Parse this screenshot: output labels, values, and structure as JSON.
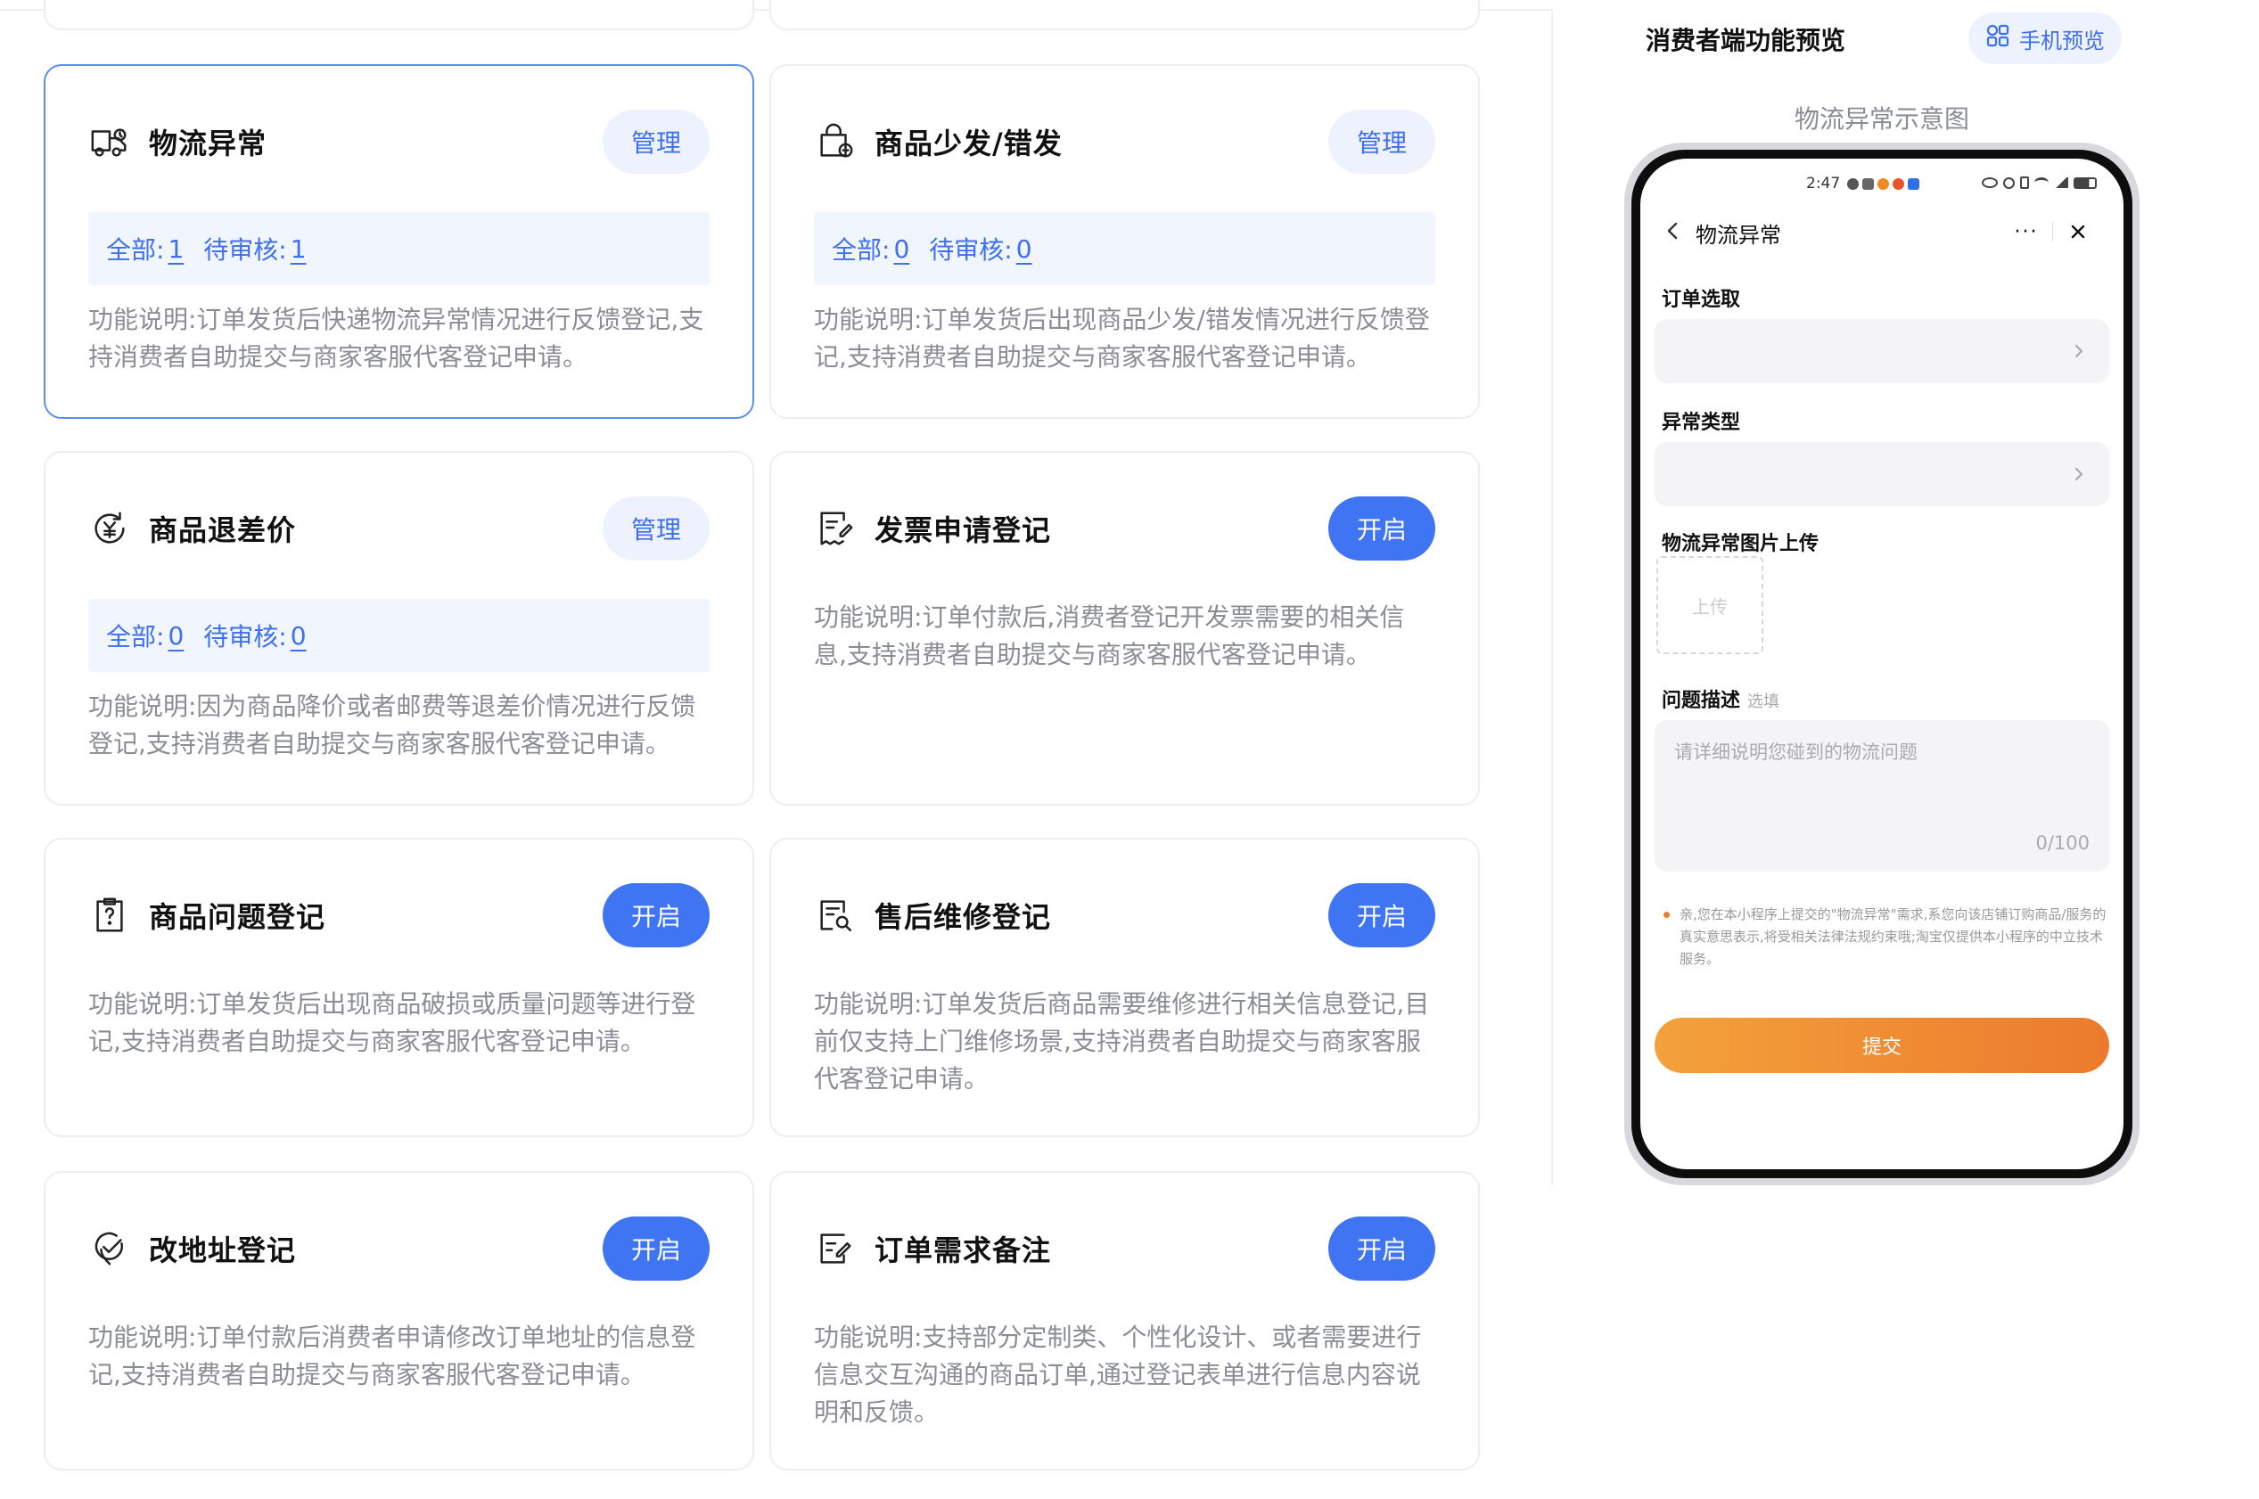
{
  "cards": [
    {
      "title": "物流异常",
      "button": "管理",
      "stats": {
        "all_label": "全部:",
        "all": "1",
        "pending_label": "待审核:",
        "pending": "1"
      },
      "desc": "功能说明:订单发货后快递物流异常情况进行反馈登记,支持消费者自助提交与商家客服代客登记申请。"
    },
    {
      "title": "商品少发/错发",
      "button": "管理",
      "stats": {
        "all_label": "全部:",
        "all": "0",
        "pending_label": "待审核:",
        "pending": "0"
      },
      "desc": "功能说明:订单发货后出现商品少发/错发情况进行反馈登记,支持消费者自助提交与商家客服代客登记申请。"
    },
    {
      "title": "商品退差价",
      "button": "管理",
      "stats": {
        "all_label": "全部:",
        "all": "0",
        "pending_label": "待审核:",
        "pending": "0"
      },
      "desc": "功能说明:因为商品降价或者邮费等退差价情况进行反馈登记,支持消费者自助提交与商家客服代客登记申请。"
    },
    {
      "title": "发票申请登记",
      "button": "开启",
      "desc": "功能说明:订单付款后,消费者登记开发票需要的相关信息,支持消费者自助提交与商家客服代客登记申请。"
    },
    {
      "title": "商品问题登记",
      "button": "开启",
      "desc": "功能说明:订单发货后出现商品破损或质量问题等进行登记,支持消费者自助提交与商家客服代客登记申请。"
    },
    {
      "title": "售后维修登记",
      "button": "开启",
      "desc": "功能说明:订单发货后商品需要维修进行相关信息登记,目前仅支持上门维修场景,支持消费者自助提交与商家客服代客登记申请。"
    },
    {
      "title": "改地址登记",
      "button": "开启",
      "desc": "功能说明:订单付款后消费者申请修改订单地址的信息登记,支持消费者自助提交与商家客服代客登记申请。"
    },
    {
      "title": "订单需求备注",
      "button": "开启",
      "desc": "功能说明:支持部分定制类、个性化设计、或者需要进行信息交互沟通的商品订单,通过登记表单进行信息内容说明和反馈。"
    }
  ],
  "panel": {
    "title": "消费者端功能预览",
    "preview_button": "手机预览",
    "caption": "物流异常示意图"
  },
  "phone": {
    "time": "2:47",
    "nav_title": "物流异常",
    "more": "···",
    "order_label": "订单选取",
    "type_label": "异常类型",
    "photo_label": "物流异常图片上传",
    "upload_text": "上传",
    "desc_label": "问题描述",
    "desc_optional": "选填",
    "desc_placeholder": "请详细说明您碰到的物流问题",
    "desc_count": "0/100",
    "notice": "亲,您在本小程序上提交的\"物流异常\"需求,系您向该店铺订购商品/服务的真实意思表示,将受相关法律法规约束哦;淘宝仅提供本小程序的中立技术服务。",
    "submit": "提交"
  },
  "colors": {
    "accent": "#3f75f2",
    "accent_light": "#edf2fe",
    "selected_border": "#5b8ef0",
    "submit_start": "#f3a13b",
    "submit_end": "#ec7a2d"
  },
  "icons": [
    "truck-icon",
    "package-icon",
    "yuan-refund-icon",
    "invoice-icon",
    "question-icon",
    "repair-icon",
    "location-icon",
    "note-icon",
    "grid-icon"
  ]
}
